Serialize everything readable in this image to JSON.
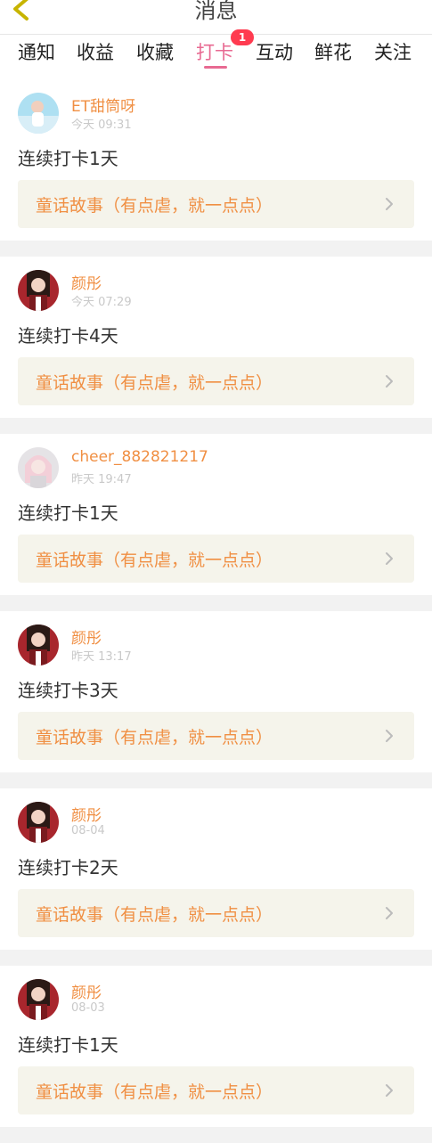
{
  "header": {
    "title": "消息"
  },
  "tabs": [
    {
      "label": "通知"
    },
    {
      "label": "收益"
    },
    {
      "label": "收藏"
    },
    {
      "label": "打卡",
      "badge": "1"
    },
    {
      "label": "互动"
    },
    {
      "label": "鲜花"
    },
    {
      "label": "关注"
    }
  ],
  "items": [
    {
      "name": "ET甜筒呀",
      "time": "今天 09:31",
      "streak": "连续打卡1天",
      "story": "童话故事（有点虐，就一点点）"
    },
    {
      "name": "颜彤",
      "time": "今天 07:29",
      "streak": "连续打卡4天",
      "story": "童话故事（有点虐，就一点点）"
    },
    {
      "name": "cheer_882821217",
      "time": "昨天 19:47",
      "streak": "连续打卡1天",
      "story": "童话故事（有点虐，就一点点）"
    },
    {
      "name": "颜彤",
      "time": "昨天 13:17",
      "streak": "连续打卡3天",
      "story": "童话故事（有点虐，就一点点）"
    },
    {
      "name": "颜彤",
      "time": "08-04",
      "streak": "连续打卡2天",
      "story": "童话故事（有点虐，就一点点）"
    },
    {
      "name": "颜彤",
      "time": "08-03",
      "streak": "连续打卡1天",
      "story": "童话故事（有点虐，就一点点）"
    }
  ],
  "colors": {
    "accent": "#e86a92",
    "name": "#f08f43",
    "badge": "#ff3b50",
    "story_bg": "#f5f4eb"
  }
}
